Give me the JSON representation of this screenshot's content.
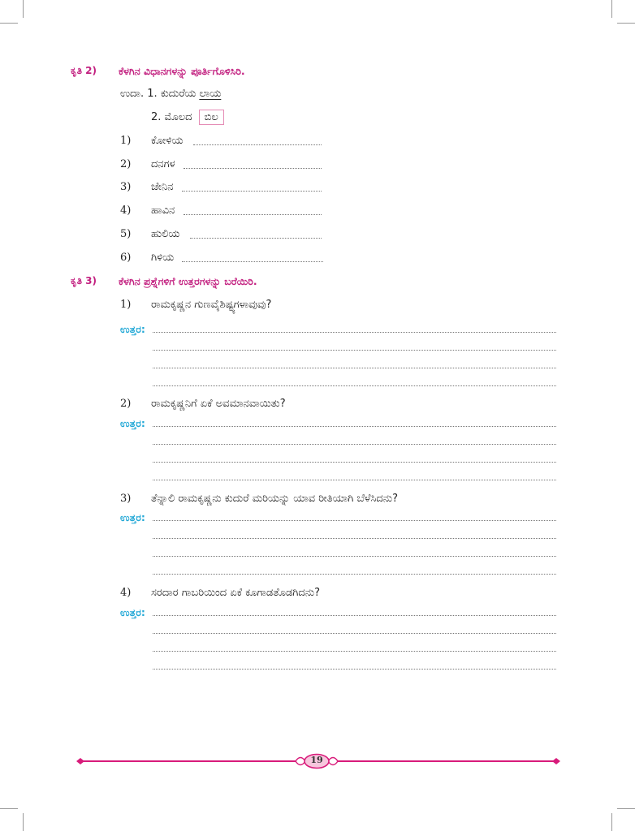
{
  "activity2": {
    "label": "ಕೃತಿ 2)",
    "title": "ಕೆಳಗಿನ ವಿಧಾನಗಳನ್ನು ಪೂರ್ತಿಗೊಳಿಸಿರಿ.",
    "example1_prefix": "ಉದಾ. 1. ಕುದುರೆಯ",
    "example1_answer": "ಲಾಯ",
    "example2_prefix": "2. ಮೊಲದ",
    "example2_answer": "ಬಿಲ",
    "items": [
      {
        "num": "1)",
        "word": "ಕೋಳಿಯ"
      },
      {
        "num": "2)",
        "word": "ದನಗಳ"
      },
      {
        "num": "3)",
        "word": "ಜೇನಿನ"
      },
      {
        "num": "4)",
        "word": "ಹಾವಿನ"
      },
      {
        "num": "5)",
        "word": "ಹುಲಿಯ"
      },
      {
        "num": "6)",
        "word": "ಗಿಳಿಯ"
      }
    ]
  },
  "activity3": {
    "label": "ಕೃತಿ 3)",
    "title": "ಕೆಳಗಿನ ಪ್ರಶ್ನೆಗಳಿಗೆ ಉತ್ತರಗಳನ್ನು ಬರೆಯಿರಿ.",
    "answer_label": "ಉತ್ತರ:",
    "questions": [
      {
        "num": "1)",
        "text": "ರಾಮಕೃಷ್ಣನ ಗುಣವೈಶಿಷ್ಟ್ಯಗಳಾವುವು?"
      },
      {
        "num": "2)",
        "text": "ರಾಮಕೃಷ್ಣನಿಗೆ ಏಕೆ ಅವಮಾನವಾಯಿತು?"
      },
      {
        "num": "3)",
        "text": "ತೆನ್ನಾಲಿ ರಾಮಕೃಷ್ಣನು ಕುದುರೆ ಮರಿಯನ್ನು ಯಾವ ರೀತಿಯಾಗಿ ಬೆಳೆಸಿದನು?"
      },
      {
        "num": "4)",
        "text": "ಸರದಾರ ಗಾಬರಿಯಿಂದ ಏಕೆ ಕೂಗಾಡತೊಡಗಿದನು?"
      }
    ]
  },
  "footer": {
    "page_number": "19",
    "accent_color": "#d81b7a",
    "badge_color": "#f7c6dd"
  }
}
